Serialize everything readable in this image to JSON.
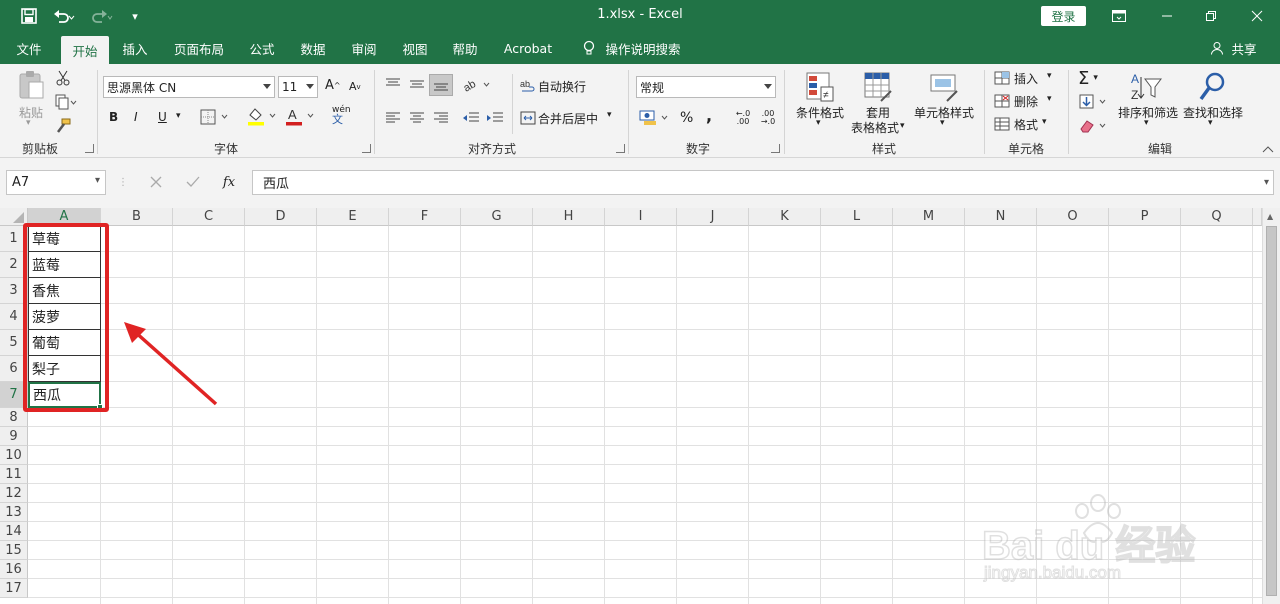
{
  "titlebar": {
    "title": "1.xlsx  -  Excel",
    "login": "登录",
    "icons": [
      "save-icon",
      "undo-icon",
      "redo-icon",
      "customize-qat-icon",
      "ribbon-display-icon",
      "minimize-icon",
      "restore-icon",
      "close-icon"
    ]
  },
  "tabs": [
    "文件",
    "开始",
    "插入",
    "页面布局",
    "公式",
    "数据",
    "审阅",
    "视图",
    "帮助",
    "Acrobat"
  ],
  "tell_me": "操作说明搜索",
  "share": "共享",
  "ribbon": {
    "clipboard": {
      "paste": "粘贴",
      "label": "剪贴板"
    },
    "font": {
      "name": "思源黑体 CN",
      "size": "11",
      "bold": "B",
      "italic": "I",
      "underline": "U",
      "label": "字体"
    },
    "alignment": {
      "wrap": "自动换行",
      "merge": "合并后居中",
      "label": "对齐方式"
    },
    "number": {
      "format": "常规",
      "percent": "%",
      "comma": ",",
      "label": "数字"
    },
    "styles": {
      "conditional": "条件格式",
      "table_line1": "套用",
      "table_line2": "表格格式",
      "cell_styles": "单元格样式",
      "label": "样式"
    },
    "cells": {
      "insert": "插入",
      "delete": "删除",
      "format": "格式",
      "label": "单元格"
    },
    "editing": {
      "sort": "排序和筛选",
      "find": "查找和选择",
      "label": "编辑"
    }
  },
  "formula_bar": {
    "name_box": "A7",
    "fx": "fx",
    "content": "西瓜"
  },
  "columns": [
    "A",
    "B",
    "C",
    "D",
    "E",
    "F",
    "G",
    "H",
    "I",
    "J",
    "K",
    "L",
    "M",
    "N",
    "O",
    "P",
    "Q"
  ],
  "rows": [
    "1",
    "2",
    "3",
    "4",
    "5",
    "6",
    "7",
    "8",
    "9",
    "10",
    "11",
    "12",
    "13",
    "14",
    "15",
    "16",
    "17"
  ],
  "cells_a": [
    "草莓",
    "蓝莓",
    "香焦",
    "菠萝",
    "葡萄",
    "梨子",
    "西瓜"
  ],
  "selected_cell": "A7",
  "annotation_color": "#e02424",
  "accent_color": "#217346",
  "watermark": {
    "brand": "Bai du 经验",
    "url": "jingyan.baidu.com"
  }
}
